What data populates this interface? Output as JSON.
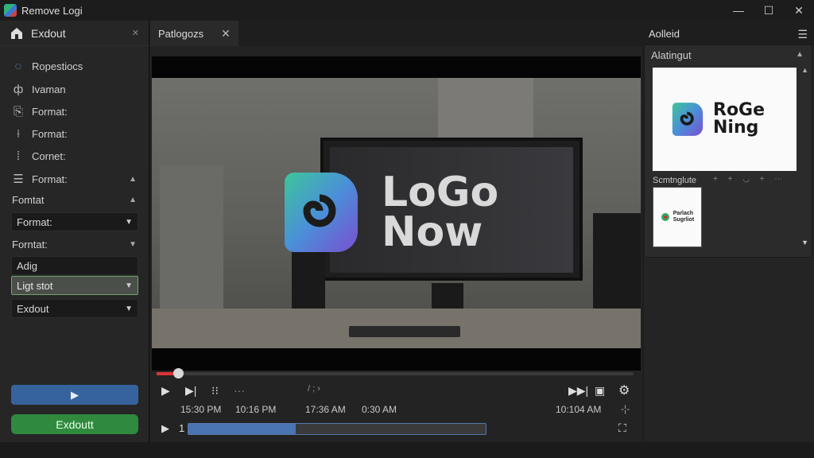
{
  "window": {
    "title": "Remove Logi",
    "minimize": "—",
    "maximize": "☐",
    "close": "✕"
  },
  "left_panel": {
    "header_label": "Exdout",
    "items": [
      {
        "label": "Ropestiocs",
        "icon": "◌"
      },
      {
        "label": "Ivaman",
        "icon": "ф"
      },
      {
        "label": "Format:",
        "icon": "⎘"
      },
      {
        "label": "Format:",
        "icon": "⟊"
      },
      {
        "label": "Cornet:",
        "icon": "⁞"
      },
      {
        "label": "Format:",
        "icon": "☰"
      }
    ],
    "section1": "Fomtat",
    "dropdown1": "Format:",
    "section2": "Forntat:",
    "input_value": "Adig",
    "dropdown2": "Ligt stot",
    "dropdown3": "Exdout",
    "play_label": "▶",
    "export_label": "Exdoutt"
  },
  "center": {
    "tab_label": "Patlogozs",
    "tab_close": "✕",
    "logo_line1": "LoGo",
    "logo_line2": "Now",
    "progress": 0.045,
    "times": [
      "15:30 PM",
      "10:16 PM",
      "17:36 AM",
      "0:30 AM",
      "10:104 AM"
    ],
    "track_number": "1",
    "track_fill": 0.36
  },
  "right_panel": {
    "header_label": "Aolleid",
    "panel_label": "Alatingut",
    "big_line1": "RoGe",
    "big_line2": "Ning",
    "sub_label": "Scmtnglute",
    "sub_icons": "+ + ◡ + ⋯",
    "small_line1": "Parlach",
    "small_line2": "Sugrliot"
  },
  "colors": {
    "accent_blue": "#36639e",
    "accent_green": "#2f8a3e",
    "timeline_red": "#dd3333"
  }
}
